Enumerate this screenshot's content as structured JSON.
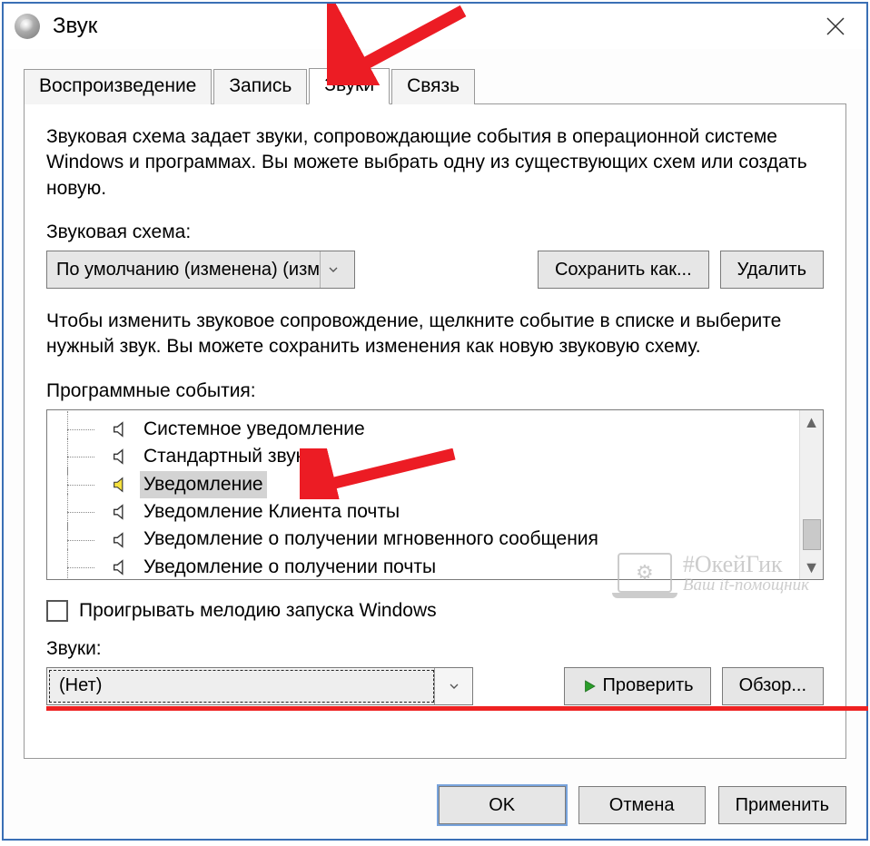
{
  "window": {
    "title": "Звук"
  },
  "tabs": [
    {
      "label": "Воспроизведение",
      "active": false
    },
    {
      "label": "Запись",
      "active": false
    },
    {
      "label": "Звуки",
      "active": true
    },
    {
      "label": "Связь",
      "active": false
    }
  ],
  "panel": {
    "description": "Звуковая схема задает звуки, сопровождающие события в операционной системе Windows и программах. Вы можете выбрать одну из существующих схем или создать новую.",
    "scheme_label": "Звуковая схема:",
    "scheme_selected": "По умолчанию (изменена) (изм",
    "save_as": "Сохранить как...",
    "delete": "Удалить",
    "events_hint": "Чтобы изменить звуковое сопровождение, щелкните событие в списке и выберите нужный звук. Вы можете сохранить изменения как новую звуковую схему.",
    "events_label": "Программные события:",
    "events": [
      {
        "label": "Системное уведомление",
        "has_sound": false,
        "selected": false
      },
      {
        "label": "Стандартный звук",
        "has_sound": false,
        "selected": false
      },
      {
        "label": "Уведомление",
        "has_sound": true,
        "selected": true
      },
      {
        "label": "Уведомление Клиента почты",
        "has_sound": false,
        "selected": false
      },
      {
        "label": "Уведомление о получении мгновенного сообщения",
        "has_sound": false,
        "selected": false
      },
      {
        "label": "Уведомление о получении почты",
        "has_sound": false,
        "selected": false,
        "clipped": true
      }
    ],
    "play_startup": "Проигрывать мелодию запуска Windows",
    "sounds_label": "Звуки:",
    "sounds_selected": "(Нет)",
    "test": "Проверить",
    "browse": "Обзор..."
  },
  "buttons": {
    "ok": "OK",
    "cancel": "Отмена",
    "apply": "Применить"
  },
  "watermark": {
    "main": "#ОкейГик",
    "sub": "Ваш it-помощник"
  },
  "annotation": {
    "arrow_color": "#ec1c24",
    "underline_color": "#ec1c24"
  }
}
